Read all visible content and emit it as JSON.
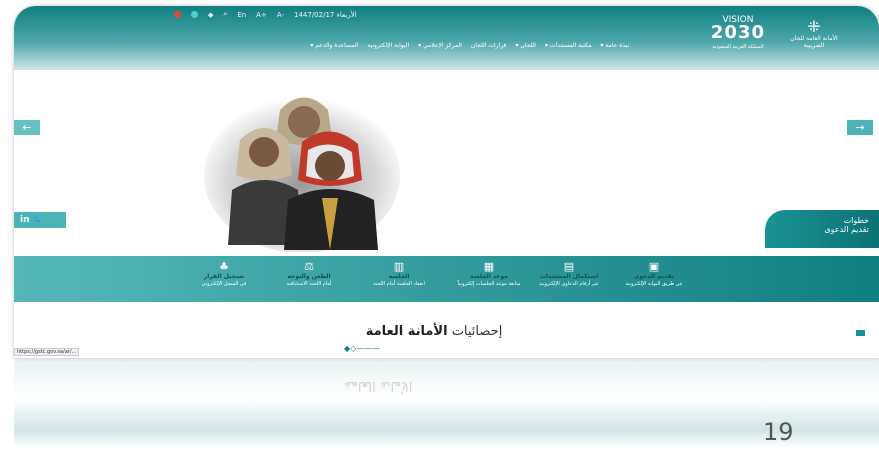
{
  "topbar": {
    "lang": "En",
    "font_plus": "A+",
    "font_minus": "A-",
    "date": "1447/02/17 ﺍﻷﺭﺑﻌﺎﺀ",
    "colors": {
      "dot_red": "#e0493b",
      "dot_teal": "#4ad0d0"
    }
  },
  "logos": {
    "vision_label": "VISION",
    "vision_year": "2030",
    "vision_sub": "ﺍﻟﻤﻤﻠﻜﺔ ﺍﻟﻌﺮﺑﻴﺔ ﺍﻟﺴﻌﻮﺩﻳﺔ",
    "gov_name": "ﺍﻷﻣﺎﻧﺔ ﺍﻟﻌﺎﻣﺔ ﻟﻠﺠﺎﻥ ﺍﻟﻀﺮﻳﺒﻴﺔ"
  },
  "nav": {
    "items": [
      "ﻧﺒﺬﺓ ﻋﺎﻣﺔ ▾",
      "ﻣﻜﺘﺒﺔ ﺍﻟﻤﺴﺘﻨﺪﺍﺕ ▾",
      "ﺍﻟﻠﺠﺎﻥ ▾",
      "ﻗﺮﺍﺭﺍﺕ ﺍﻟﻠﺠﺎﻥ",
      "ﺍﻟﻤﺮﻛﺰ ﺍﻹﻋﻼﻣﻲ ▾",
      "ﺍﻟﺒﻮﺍﺑﺔ ﺍﻹﻟﻜﺘﺮﻭﻧﻴﺔ",
      "ﺍﻟﻤﺴﺎﻋﺪﺓ ﻭﺍﻟﺪﻋﻢ ▾"
    ]
  },
  "hero": {
    "prev": "←",
    "next": "→",
    "social": "in  🐦",
    "steps_line1": "ﺧﻄﻮﺍﺕ",
    "steps_line2": "ﺗﻘﺪﻳﻢ ﺍﻟﺪﻋﻮﻯ"
  },
  "services": [
    {
      "icon": "▣",
      "title": "ﺗﻘﺪﻳﻢ ﺍﻟﺪﻋﻮﻯ",
      "desc": "ﻋﻦ ﻃﺮﻳﻖ ﺍﻟﺒﻮﺍﺑﺔ ﺍﻹﻟﻜﺘﺮﻭﻧﻴﺔ"
    },
    {
      "icon": "▤",
      "title": "ﺍﺳﺘﻜﻤﺎﻝ ﺍﻟﻤﺴﺘﻨﺪﺍﺕ",
      "desc": "ﻋﺒﺮ ﺃﺭﻗﺎﻡ ﺍﻟﺪﻋﺎﻭﻯ ﺍﻹﻟﻜﺘﺮﻭﻧﻴﺔ"
    },
    {
      "icon": "▦",
      "title": "ﻣﻮﻋﺪ ﺍﻟﺠﻠﺴﺔ",
      "desc": "ﻣﺘﺎﺑﻌﺔ ﻣﻮﻋﺪ ﺍﻟﺠﻠﺴﺎﺕ ﺇﻟﻜﺘﺮﻭﻧﻴﺎً"
    },
    {
      "icon": "▥",
      "title": "ﺍﻟﺠﻠﺴﺔ",
      "desc": "ﺍﻧﻌﻘﺎﺩ ﺍﻟﺠﻠﺴﺔ ﺃﻣﺎﻡ ﺍﻟﻠﺠﻨﺔ"
    },
    {
      "icon": "⚖",
      "title": "ﺍﻟﻄﻌﻦ ﻭﺍﻟﺘﻮﺟﻪ",
      "desc": "ﺃﻣﺎﻡ ﺍﻟﻠﺠﻨﺔ ﺍﻻﺳﺘﺌﻨﺎﻓﻴﺔ"
    },
    {
      "icon": "♣",
      "title": "ﺗﺴﺠﻴﻞ ﺍﻟﻘﺮﺍﺭ",
      "desc": "ﻓﻲ ﺍﻟﺴﺠﻞ ﺍﻹﻟﻜﺘﺮﻭﻧﻲ"
    }
  ],
  "stats": {
    "title_light": "ﺇﺣﺼﺎﺋﻴﺎﺕ",
    "title_bold": "ﺍﻷﻣﺎﻧﺔ ﺍﻟﻌﺎﻣﺔ",
    "url_hint": "https://gstc.gov.sa/ar/..."
  },
  "slide": {
    "page_number": "19"
  }
}
